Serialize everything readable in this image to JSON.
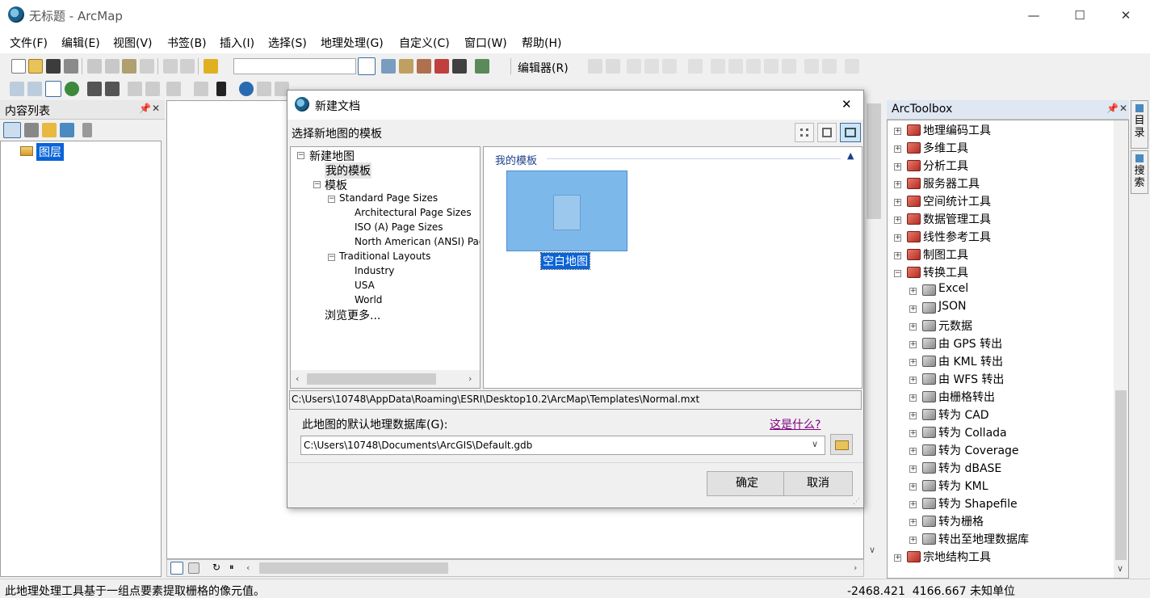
{
  "window": {
    "title": "无标题 - ArcMap",
    "minimize": "—",
    "maximize": "☐",
    "close": "✕"
  },
  "menu": [
    "文件(F)",
    "编辑(E)",
    "视图(V)",
    "书签(B)",
    "插入(I)",
    "选择(S)",
    "地理处理(G)",
    "自定义(C)",
    "窗口(W)",
    "帮助(H)"
  ],
  "toolbar": {
    "editor_label": "编辑器(R)"
  },
  "toc": {
    "title": "内容列表",
    "layers_label": "图层"
  },
  "toolbox": {
    "title": "ArcToolbox",
    "items": [
      {
        "label": "地理编码工具",
        "expanded": false
      },
      {
        "label": "多维工具",
        "expanded": false
      },
      {
        "label": "分析工具",
        "expanded": false
      },
      {
        "label": "服务器工具",
        "expanded": false
      },
      {
        "label": "空间统计工具",
        "expanded": false
      },
      {
        "label": "数据管理工具",
        "expanded": false
      },
      {
        "label": "线性参考工具",
        "expanded": false
      },
      {
        "label": "制图工具",
        "expanded": false
      },
      {
        "label": "转换工具",
        "expanded": true
      }
    ],
    "conversion_children": [
      "Excel",
      "JSON",
      "元数据",
      "由 GPS 转出",
      "由 KML 转出",
      "由 WFS 转出",
      "由栅格转出",
      "转为 CAD",
      "转为 Collada",
      "转为 Coverage",
      "转为 dBASE",
      "转为 KML",
      "转为 Shapefile",
      "转为栅格",
      "转出至地理数据库"
    ],
    "last_item": "宗地结构工具"
  },
  "side_tabs": {
    "catalog": "目录",
    "search": "搜索"
  },
  "dialog": {
    "title": "新建文档",
    "subtitle": "选择新地图的模板",
    "tree": {
      "root": "新建地图",
      "my_templates": "我的模板",
      "templates": "模板",
      "standard": "Standard Page Sizes",
      "architectural": "Architectural Page Sizes",
      "iso": "ISO (A) Page Sizes",
      "north_american": "North American (ANSI) Page Sizes",
      "traditional": "Traditional Layouts",
      "industry": "Industry",
      "usa": "USA",
      "world": "World",
      "browse": "浏览更多..."
    },
    "section_title": "我的模板",
    "template_name": "空白地图",
    "path": "C:\\Users\\10748\\AppData\\Roaming\\ESRI\\Desktop10.2\\ArcMap\\Templates\\Normal.mxt",
    "gdb_label": "此地图的默认地理数据库(G):",
    "whats_this": "这是什么?",
    "gdb_value": "C:\\Users\\10748\\Documents\\ArcGIS\\Default.gdb",
    "ok": "确定",
    "cancel": "取消"
  },
  "status": {
    "message": "此地理处理工具基于一组点要素提取栅格的像元值。",
    "coords": "-2468.421  4166.667 未知单位"
  }
}
